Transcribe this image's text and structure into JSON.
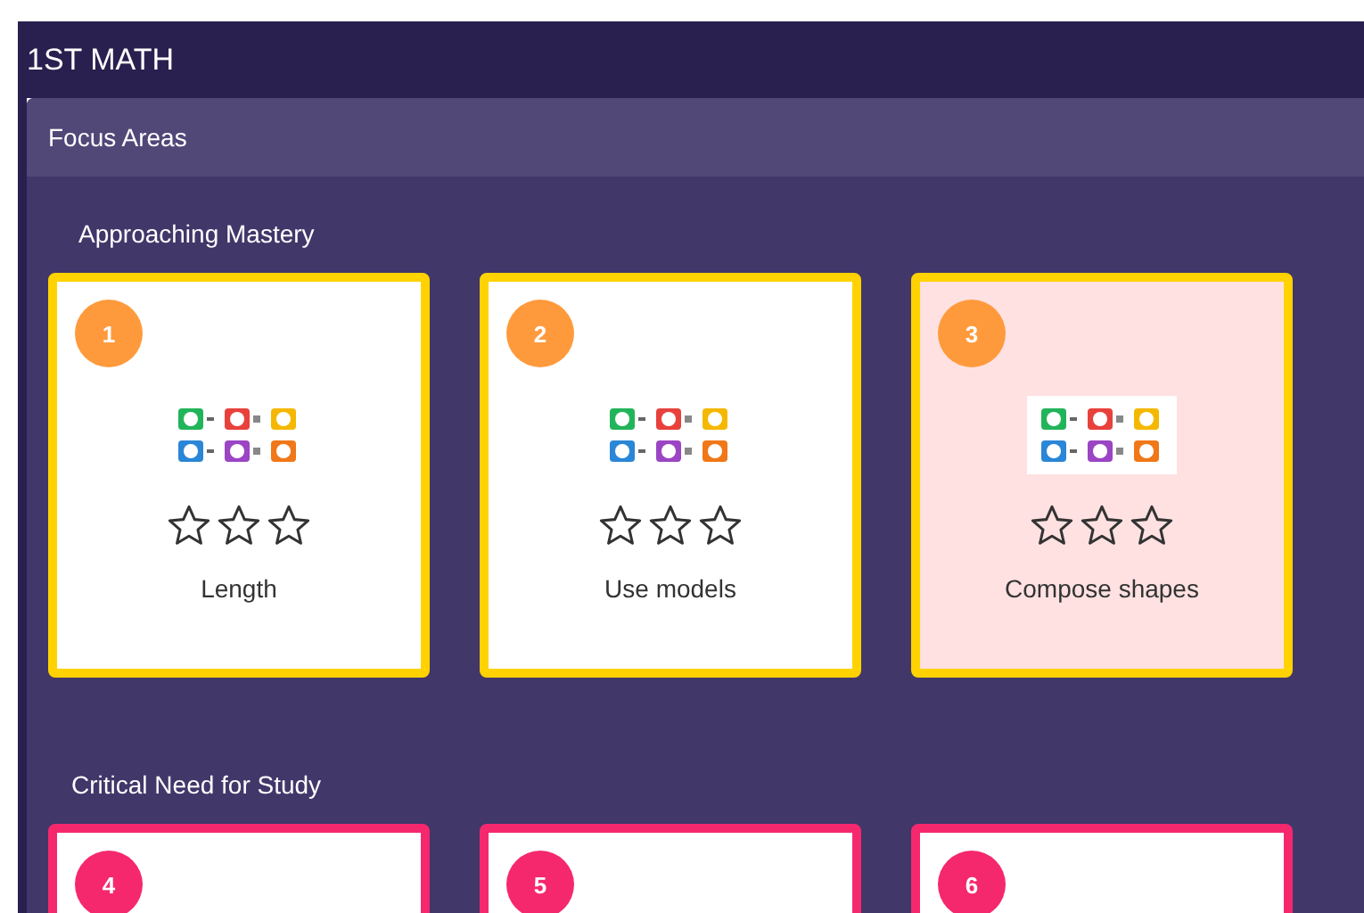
{
  "header": {
    "title": "1ST MATH"
  },
  "panel": {
    "title": "Focus Areas"
  },
  "sections": [
    {
      "title": "Approaching Mastery",
      "color": "#ffd200",
      "cards": [
        {
          "number": "1",
          "stars": 0,
          "label": "Length",
          "selected": false
        },
        {
          "number": "2",
          "stars": 0,
          "label": "Use models",
          "selected": false
        },
        {
          "number": "3",
          "stars": 0,
          "label": "Compose shapes",
          "selected": true
        }
      ]
    },
    {
      "title": "Critical Need for Study",
      "color": "#f5286e",
      "cards": [
        {
          "number": "4",
          "selected": false
        },
        {
          "number": "5",
          "selected": false
        },
        {
          "number": "6",
          "selected": false
        }
      ]
    }
  ]
}
